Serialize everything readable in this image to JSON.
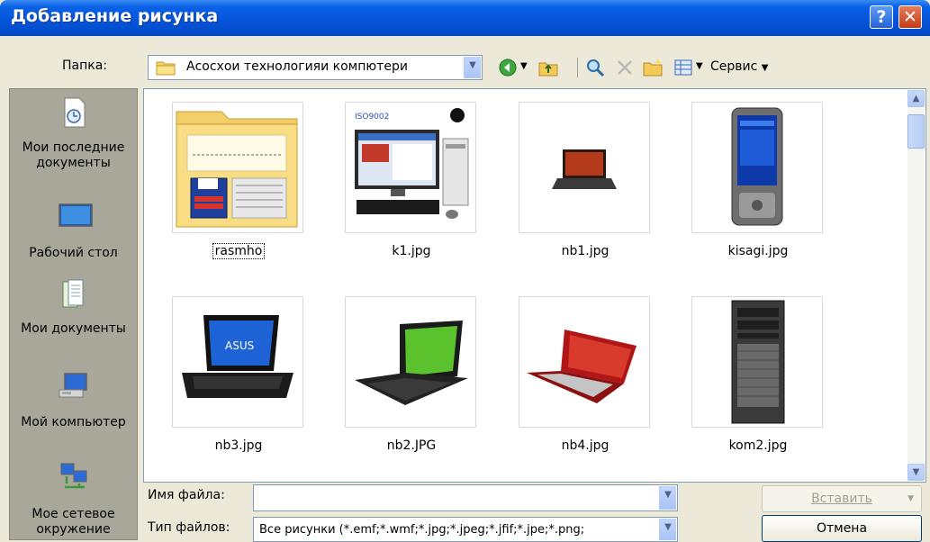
{
  "window": {
    "title": "Добавление рисунка",
    "help_glyph": "?",
    "close_glyph": "✕"
  },
  "toolbar": {
    "folder_label": "Папка:",
    "folder_value": "Асосхои технологияи компютери",
    "tools_label": "Сервис",
    "icons": [
      "back-icon",
      "up-folder-icon",
      "search-web-icon",
      "delete-icon",
      "new-folder-icon",
      "views-icon"
    ]
  },
  "places": [
    {
      "label": "Мои последние документы",
      "icon": "recent-documents-icon"
    },
    {
      "label": "Рабочий стол",
      "icon": "desktop-icon"
    },
    {
      "label": "Мои документы",
      "icon": "my-documents-icon"
    },
    {
      "label": "Мой компьютер",
      "icon": "my-computer-icon"
    },
    {
      "label": "Мое сетевое окружение",
      "icon": "network-icon"
    }
  ],
  "files": [
    {
      "name": "rasmho",
      "type": "folder"
    },
    {
      "name": "k1.jpg",
      "type": "image"
    },
    {
      "name": "nb1.jpg",
      "type": "image"
    },
    {
      "name": "kisagi.jpg",
      "type": "image"
    },
    {
      "name": "nb3.jpg",
      "type": "image"
    },
    {
      "name": "nb2.JPG",
      "type": "image"
    },
    {
      "name": "nb4.jpg",
      "type": "image"
    },
    {
      "name": "kom2.jpg",
      "type": "image"
    }
  ],
  "file_name": {
    "label": "Имя файла:",
    "value": ""
  },
  "file_type": {
    "label": "Тип файлов:",
    "value": "Все рисунки (*.emf;*.wmf;*.jpg;*.jpeg;*.jfif;*.jpe;*.png;"
  },
  "buttons": {
    "insert": "Вставить",
    "cancel": "Отмена"
  },
  "colors": {
    "title_bar": "#0553D8",
    "dialog_bg": "#ECE9D8",
    "places_bg": "#A9A69A",
    "close": "#C43B15"
  }
}
